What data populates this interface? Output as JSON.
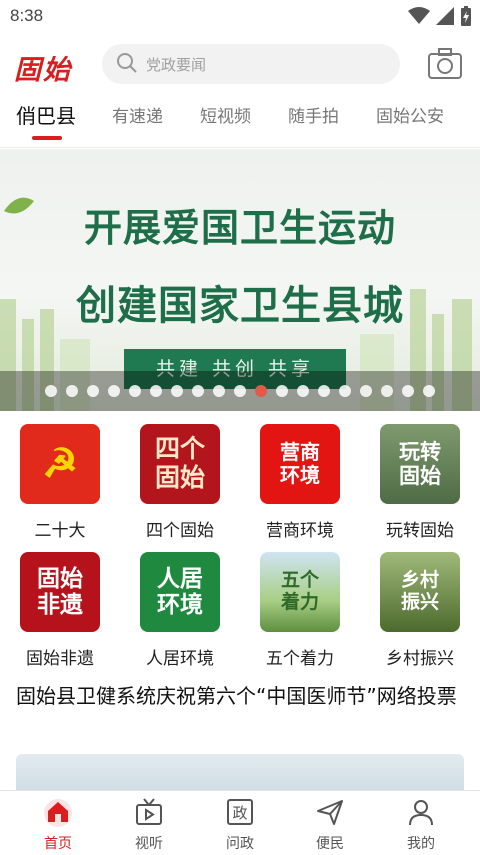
{
  "status": {
    "time": "8:38"
  },
  "header": {
    "logo": "固始",
    "search_placeholder": "党政要闻"
  },
  "tabs": [
    {
      "label": "俏巴县"
    },
    {
      "label": "有速递"
    },
    {
      "label": "短视频"
    },
    {
      "label": "随手拍"
    },
    {
      "label": "固始公安"
    }
  ],
  "banner": {
    "line1": "开展爱国卫生运动",
    "line2": "创建国家卫生县城",
    "slogan": "共建 共创 共享",
    "dot_count": 19,
    "active_dot": 10
  },
  "grid": [
    {
      "label": "二十大",
      "tile": "☭",
      "icon": "party-emblem-icon"
    },
    {
      "label": "四个固始",
      "tile": "四个 固始",
      "icon": "four-gushi-icon"
    },
    {
      "label": "营商环境",
      "tile": "营商 环境",
      "icon": "business-environment-icon"
    },
    {
      "label": "玩转固始",
      "tile": "玩转 固始",
      "icon": "play-gushi-icon"
    },
    {
      "label": "固始非遗",
      "tile": "固始 非遗",
      "icon": "heritage-icon"
    },
    {
      "label": "人居环境",
      "tile": "人居 环境",
      "icon": "living-environment-icon"
    },
    {
      "label": "五个着力",
      "tile": "五个 着力",
      "icon": "five-efforts-icon"
    },
    {
      "label": "乡村振兴",
      "tile": "乡村 振兴",
      "icon": "rural-revitalization-icon"
    }
  ],
  "headline": "固始县卫健系统庆祝第六个“中国医师节”网络投票",
  "bottom_nav": [
    {
      "label": "首页",
      "icon": "home-icon",
      "active": true
    },
    {
      "label": "视听",
      "icon": "tv-icon",
      "active": false
    },
    {
      "label": "问政",
      "icon": "politics-icon",
      "active": false
    },
    {
      "label": "便民",
      "icon": "send-icon",
      "active": false
    },
    {
      "label": "我的",
      "icon": "user-icon",
      "active": false
    }
  ],
  "colors": {
    "accent": "#d81e1e",
    "banner_green": "#1f7a52"
  }
}
